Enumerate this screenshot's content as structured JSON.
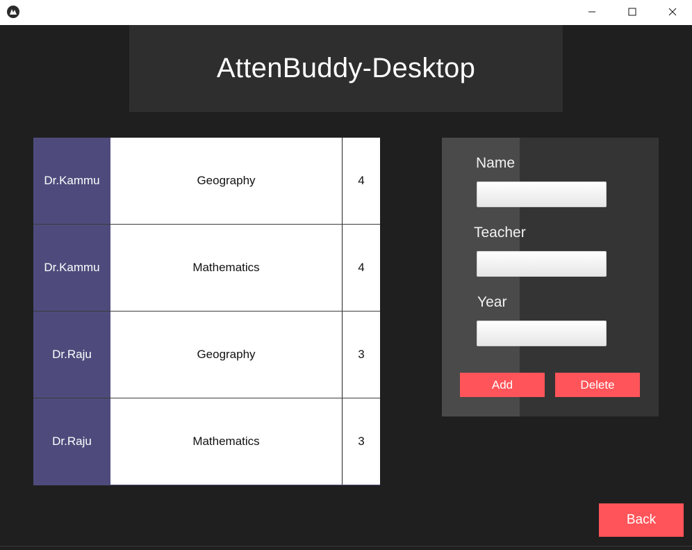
{
  "window": {
    "icon": "kivy-logo-icon",
    "controls": [
      "minimize-icon",
      "maximize-icon",
      "close-icon"
    ]
  },
  "header": {
    "title": "AttenBuddy-Desktop"
  },
  "table": {
    "rows": [
      {
        "teacher": "Dr.Kammu",
        "subject": "Geography",
        "year": "4"
      },
      {
        "teacher": "Dr.Kammu",
        "subject": "Mathematics",
        "year": "4"
      },
      {
        "teacher": "Dr.Raju",
        "subject": "Geography",
        "year": "3"
      },
      {
        "teacher": "Dr.Raju",
        "subject": "Mathematics",
        "year": "3"
      }
    ]
  },
  "form": {
    "name_label": "Name",
    "name_value": "",
    "teacher_label": "Teacher",
    "teacher_value": "",
    "year_label": "Year",
    "year_value": "",
    "add_label": "Add",
    "delete_label": "Delete"
  },
  "footer": {
    "back_label": "Back"
  },
  "colors": {
    "accent": "#ff5459",
    "teacher_cell": "#4e4b7c",
    "background": "#1f1f1f",
    "header_bg": "#2e2e2e"
  }
}
